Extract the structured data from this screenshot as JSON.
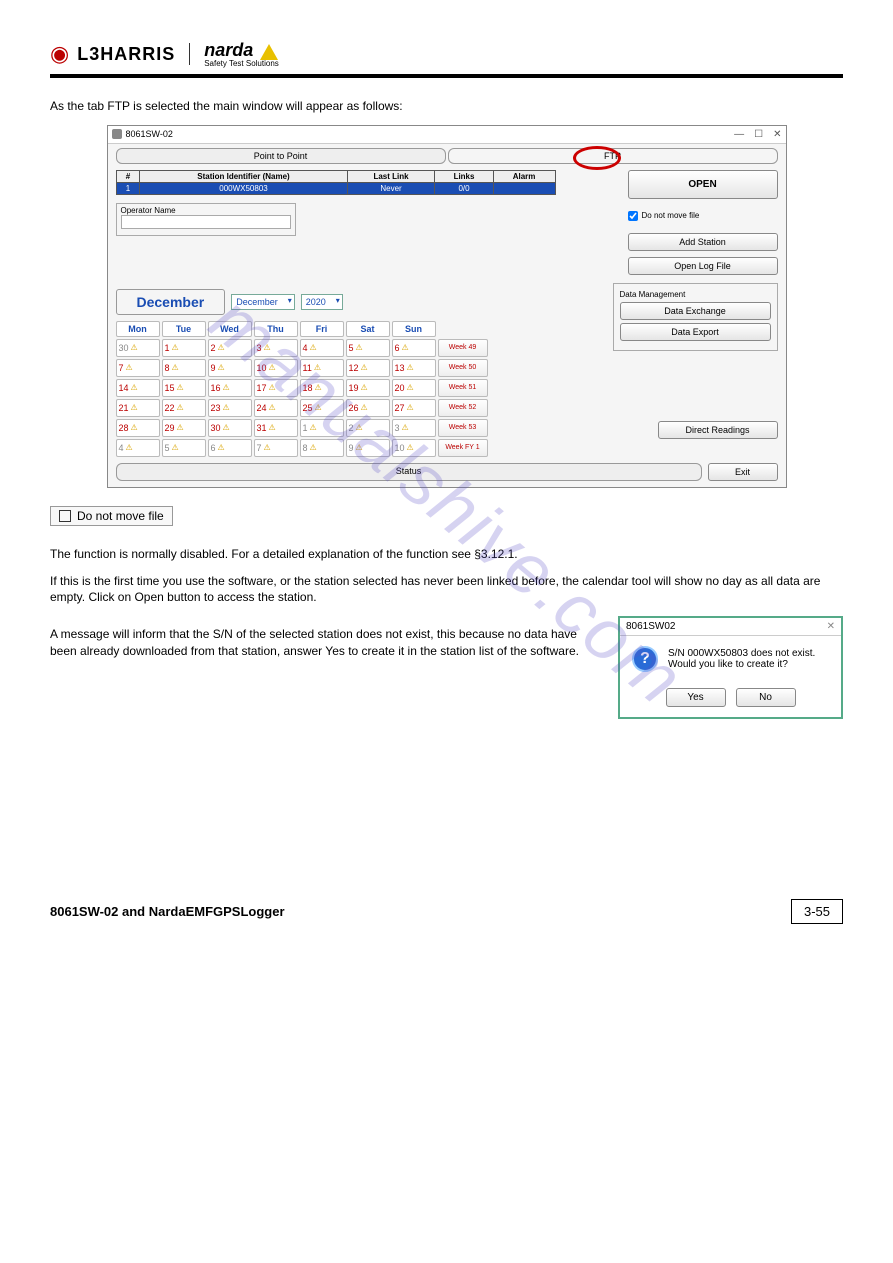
{
  "header": {
    "logo1": "L3HARRIS",
    "logo2": "narda",
    "logo2_sub": "Safety Test Solutions"
  },
  "intro_text": "As the tab FTP is selected the main window will appear as follows:",
  "app": {
    "title": "8061SW-02",
    "tabs": {
      "ptp": "Point to Point",
      "ftp": "FTP"
    },
    "win_btns": {
      "min": "—",
      "max": "☐",
      "close": "✕"
    },
    "table": {
      "headers": {
        "n": "#",
        "id": "Station Identifier (Name)",
        "last": "Last Link",
        "links": "Links",
        "alarm": "Alarm"
      },
      "row": {
        "n": "1",
        "id": "000WX50803",
        "last": "Never",
        "links": "0/0",
        "alarm": ""
      }
    },
    "operator_label": "Operator Name",
    "btn_open": "OPEN",
    "chk_dnm": "Do not move file",
    "btn_add": "Add Station",
    "btn_log": "Open Log File",
    "dm_title": "Data Management",
    "btn_dex": "Data Exchange",
    "btn_dexp": "Data Export",
    "btn_dr": "Direct Readings",
    "btn_exit": "Exit",
    "status": "Status",
    "cal": {
      "title": "December",
      "month_sel": "December",
      "year_sel": "2020",
      "days": [
        "Mon",
        "Tue",
        "Wed",
        "Thu",
        "Fri",
        "Sat",
        "Sun"
      ],
      "weeks": [
        {
          "wk": "Week 49",
          "cells": [
            {
              "d": "30",
              "o": true
            },
            {
              "d": "1"
            },
            {
              "d": "2"
            },
            {
              "d": "3"
            },
            {
              "d": "4"
            },
            {
              "d": "5"
            },
            {
              "d": "6"
            }
          ]
        },
        {
          "wk": "Week 50",
          "cells": [
            {
              "d": "7"
            },
            {
              "d": "8"
            },
            {
              "d": "9"
            },
            {
              "d": "10"
            },
            {
              "d": "11"
            },
            {
              "d": "12"
            },
            {
              "d": "13"
            }
          ]
        },
        {
          "wk": "Week 51",
          "cells": [
            {
              "d": "14"
            },
            {
              "d": "15"
            },
            {
              "d": "16"
            },
            {
              "d": "17"
            },
            {
              "d": "18"
            },
            {
              "d": "19"
            },
            {
              "d": "20"
            }
          ]
        },
        {
          "wk": "Week 52",
          "cells": [
            {
              "d": "21"
            },
            {
              "d": "22"
            },
            {
              "d": "23"
            },
            {
              "d": "24"
            },
            {
              "d": "25"
            },
            {
              "d": "26"
            },
            {
              "d": "27"
            }
          ]
        },
        {
          "wk": "Week 53",
          "cells": [
            {
              "d": "28"
            },
            {
              "d": "29"
            },
            {
              "d": "30"
            },
            {
              "d": "31"
            },
            {
              "d": "1",
              "o": true
            },
            {
              "d": "2",
              "o": true
            },
            {
              "d": "3",
              "o": true
            }
          ]
        },
        {
          "wk": "Week FY 1",
          "cells": [
            {
              "d": "4",
              "o": true
            },
            {
              "d": "5",
              "o": true
            },
            {
              "d": "6",
              "o": true
            },
            {
              "d": "7",
              "o": true
            },
            {
              "d": "8",
              "o": true
            },
            {
              "d": "9",
              "o": true
            },
            {
              "d": "10",
              "o": true
            }
          ]
        }
      ]
    }
  },
  "note_chk": "Do not move file",
  "note_para1": "The function is normally disabled. For a detailed explanation of the function see §3.12.1.",
  "note_para2": "If this is the first time you use the software, or the station selected has never been linked before, the calendar tool will show no day as all data are empty. Click on Open button to access the station.",
  "note_para3": "A message will inform that the S/N of the selected station does not exist, this because no data have been already downloaded from that station, answer Yes to create it in the station list of the software.",
  "dialog": {
    "title": "8061SW02",
    "msg1": "S/N 000WX50803 does not exist.",
    "msg2": "Would you like to create it?",
    "yes": "Yes",
    "no": "No"
  },
  "footer": {
    "label": "8061SW-02 and NardaEMFGPSLogger",
    "page": "3-55"
  },
  "watermark": "manualshive.com"
}
